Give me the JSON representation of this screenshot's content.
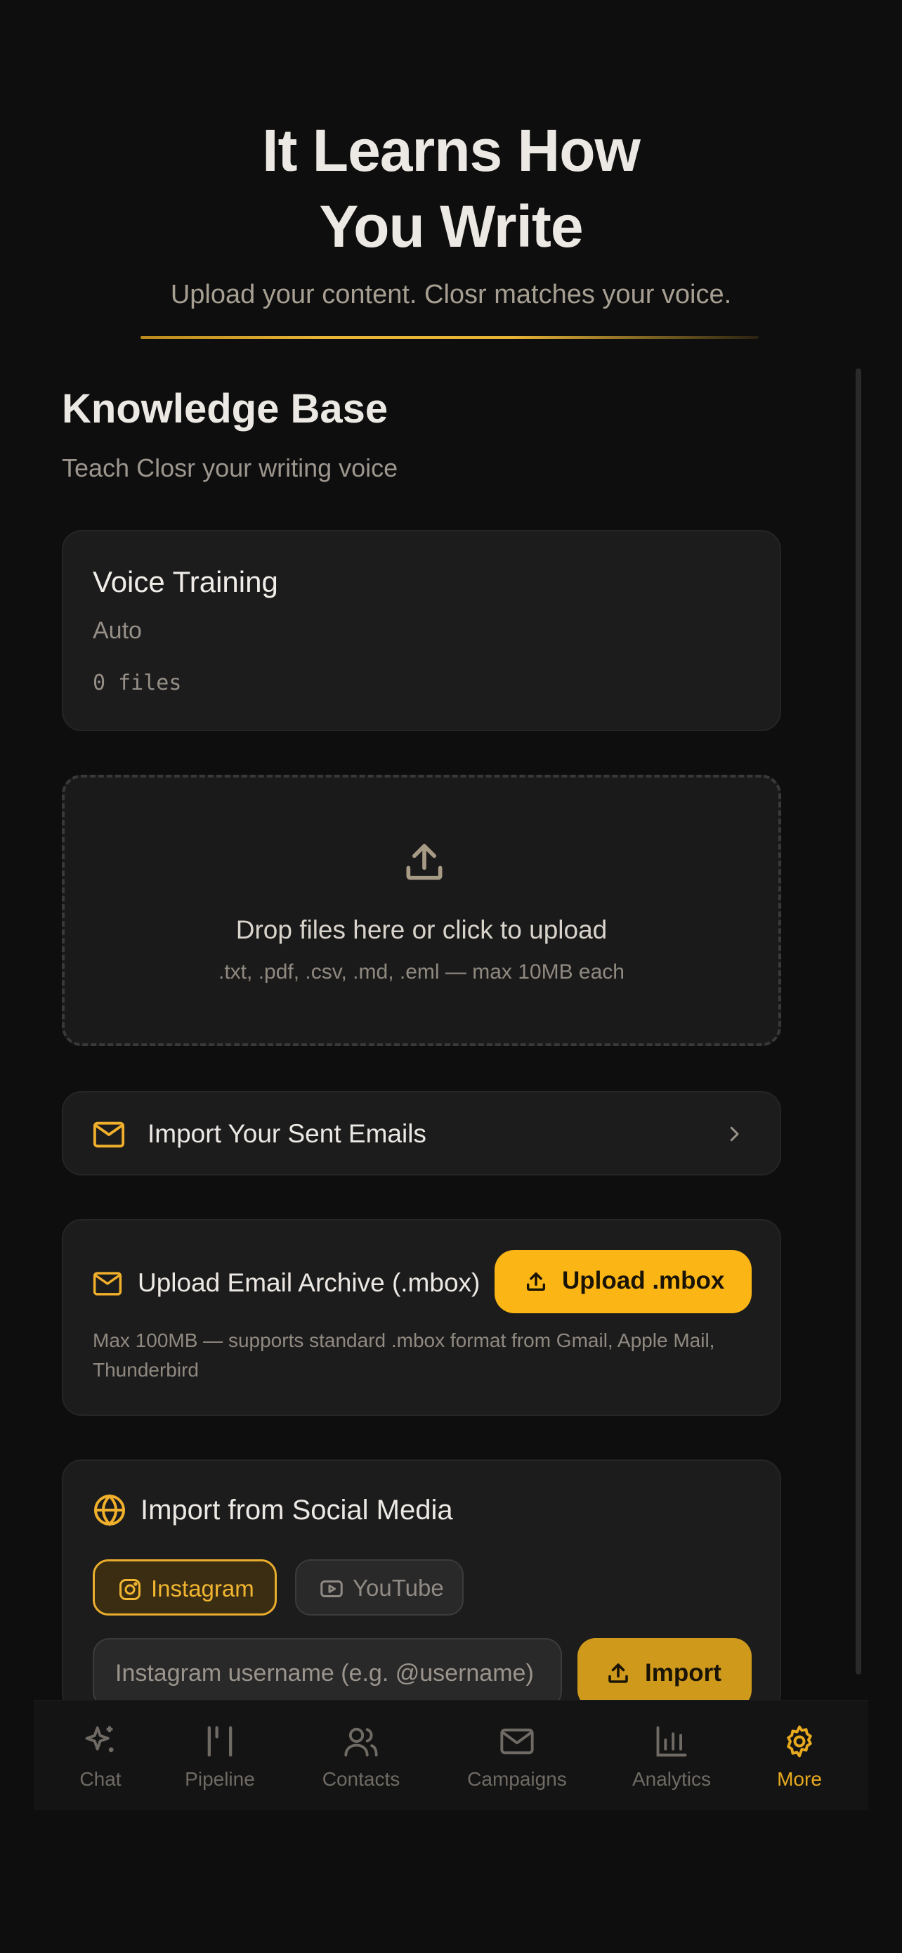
{
  "hero": {
    "title_line1": "It Learns How",
    "title_line2": "You Write",
    "subtitle": "Upload your content. Closr matches your voice."
  },
  "knowledge_base": {
    "title": "Knowledge Base",
    "subtitle": "Teach Closr your writing voice"
  },
  "voice_training": {
    "title": "Voice Training",
    "mode": "Auto",
    "files": "0 files"
  },
  "dropzone": {
    "title": "Drop files here or click to upload",
    "hint": ".txt, .pdf, .csv, .md, .eml — max 10MB each",
    "icon": "upload-icon"
  },
  "sent_emails": {
    "label": "Import Your Sent Emails",
    "icon": "mail-icon"
  },
  "mbox": {
    "label": "Upload Email Archive (.mbox)",
    "button": "Upload .mbox",
    "hint": "Max 100MB — supports standard .mbox format from Gmail, Apple Mail, Thunderbird"
  },
  "social": {
    "title": "Import from Social Media",
    "tabs": [
      "Instagram",
      "YouTube"
    ],
    "active_tab": "Instagram",
    "placeholder": "Instagram username (e.g. @username)",
    "import_button": "Import"
  },
  "nav": {
    "items": [
      "Chat",
      "Pipeline",
      "Contacts",
      "Campaigns",
      "Analytics",
      "More"
    ],
    "active": "More"
  },
  "colors": {
    "background": "#0e0e0e",
    "card": "#1d1c1d",
    "accent": "#fbb616",
    "muted_text": "#958f87"
  }
}
